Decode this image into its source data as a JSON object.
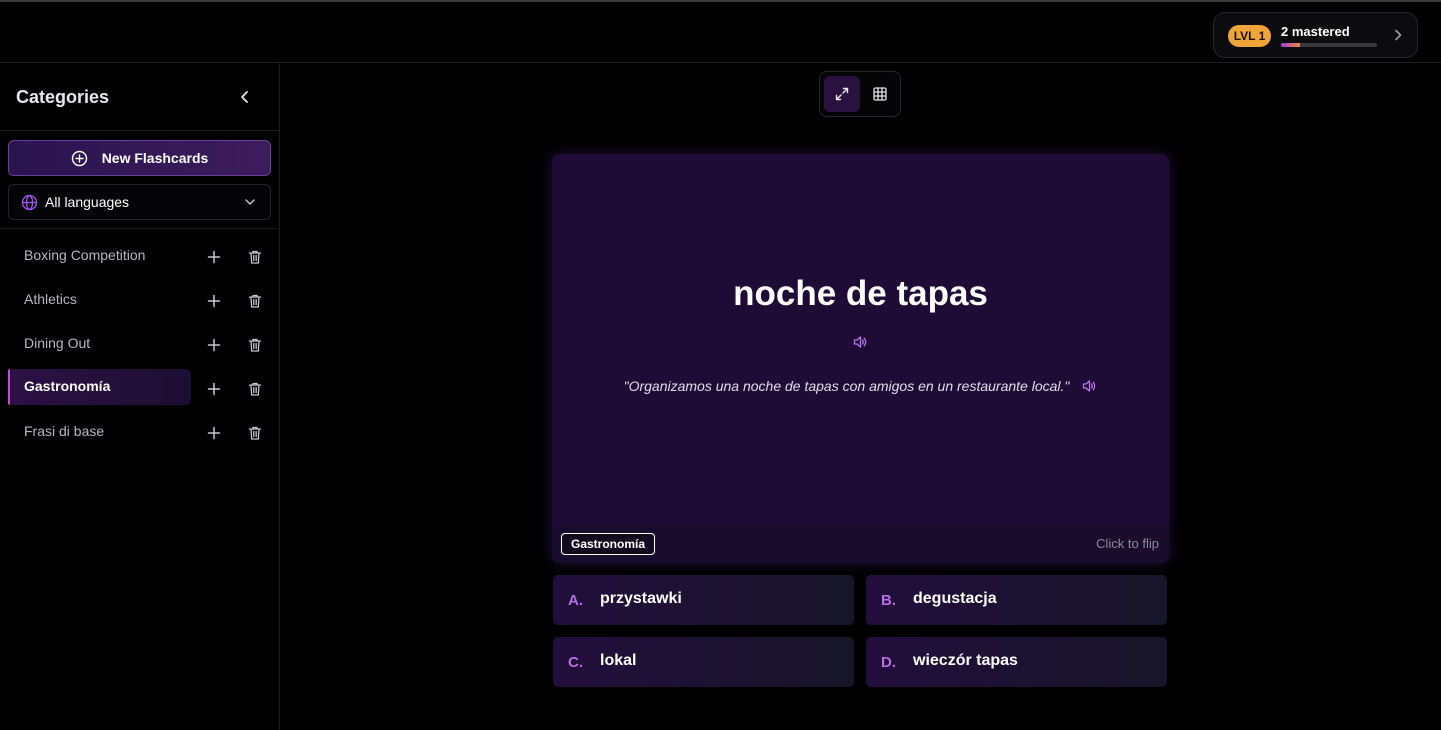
{
  "header": {
    "level_label": "LVL 1",
    "mastered_label": "2 mastered",
    "mastered_progress": 0.2
  },
  "sidebar": {
    "title": "Categories",
    "new_button_label": "New Flashcards",
    "language_select": {
      "value": "All languages"
    },
    "categories": [
      {
        "label": "Boxing Competition",
        "active": false
      },
      {
        "label": "Athletics",
        "active": false
      },
      {
        "label": "Dining Out",
        "active": false
      },
      {
        "label": "Gastronomía",
        "active": true
      },
      {
        "label": "Frasi di base",
        "active": false
      }
    ]
  },
  "view_toggle": {
    "selected": "focus"
  },
  "card": {
    "word": "noche de tapas",
    "example": "\"Organizamos una noche de tapas con amigos en un restaurante local.\"",
    "tag": "Gastronomía",
    "hint": "Click to flip"
  },
  "answers": [
    {
      "letter": "A.",
      "text": "przystawki"
    },
    {
      "letter": "B.",
      "text": "degustacja"
    },
    {
      "letter": "C.",
      "text": "lokal"
    },
    {
      "letter": "D.",
      "text": "wieczór tapas"
    }
  ],
  "colors": {
    "accent": "#c44bd4",
    "level_badge": "#f0a43a",
    "card_bg": "#1f0c36"
  },
  "icons": {
    "collapse": "chevron-left-icon",
    "new": "plus-circle-icon",
    "language": "globe-icon",
    "dropdown": "chevron-down-icon",
    "add": "plus-icon",
    "delete": "trash-icon",
    "focus_view": "expand-icon",
    "grid_view": "grid-icon",
    "audio": "speaker-icon",
    "open": "chevron-right-icon"
  }
}
